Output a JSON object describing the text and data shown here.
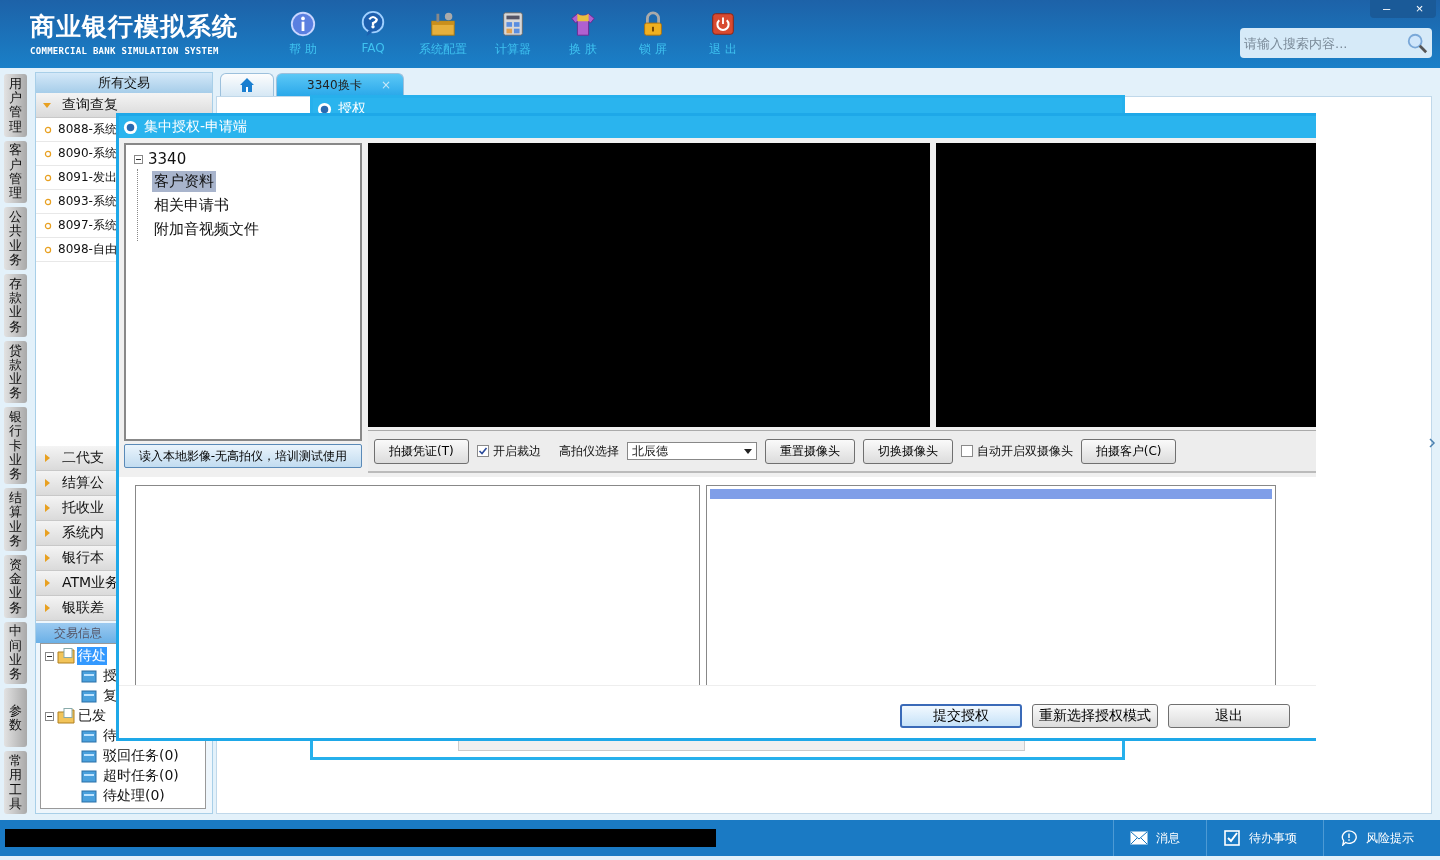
{
  "header": {
    "title": "商业银行模拟系统",
    "subtitle": "COMMERCIAL BANK SIMULATION SYSTEM",
    "tools": [
      {
        "kind": "info",
        "label": "帮 助"
      },
      {
        "kind": "faq",
        "label": "FAQ"
      },
      {
        "kind": "config",
        "label": "系统配置"
      },
      {
        "kind": "calculator",
        "label": "计算器"
      },
      {
        "kind": "skin",
        "label": "换 肤"
      },
      {
        "kind": "lock",
        "label": "锁 屏"
      },
      {
        "kind": "exit",
        "label": "退 出"
      }
    ],
    "window_controls": [
      "–",
      "×"
    ],
    "search": {
      "placeholder": "请输入搜索内容..."
    }
  },
  "side_tabs": [
    "用户管理",
    "客户管理",
    "公共业务",
    "存款业务",
    "贷款业务",
    "银行卡业务",
    "结算业务",
    "资金业务",
    "中间业务",
    "参数",
    "常用工具"
  ],
  "transactions": {
    "title": "所有交易",
    "groups": [
      {
        "label": "查询查复",
        "expanded": true,
        "items": [
          "8088-系统",
          "8090-系统",
          "8091-发出",
          "8093-系统",
          "8097-系统",
          "8098-自由"
        ]
      },
      {
        "label": "二代支",
        "expanded": false
      },
      {
        "label": "结算公",
        "expanded": false
      },
      {
        "label": "托收业",
        "expanded": false
      },
      {
        "label": "系统内",
        "expanded": false
      },
      {
        "label": "银行本",
        "expanded": false
      },
      {
        "label": "ATM业务",
        "expanded": false
      },
      {
        "label": "银联差",
        "expanded": false
      }
    ]
  },
  "info_panel": {
    "title": "交易信息",
    "tree": [
      {
        "label": "待处",
        "expanded": true,
        "selected": true,
        "children": [
          {
            "label": "授",
            "selected": false
          },
          {
            "label": "复",
            "selected": false
          }
        ]
      },
      {
        "label": "已发",
        "expanded": true,
        "selected": false,
        "children": [
          {
            "label": "待",
            "selected": false
          },
          {
            "label": "驳回任务(0)",
            "selected": false
          },
          {
            "label": "超时任务(0)",
            "selected": false
          },
          {
            "label": "待处理(0)",
            "selected": false
          }
        ]
      }
    ]
  },
  "tabs": [
    {
      "kind": "home",
      "selected": false
    },
    {
      "kind": "text",
      "label": "3340换卡",
      "close": "×",
      "selected": true
    }
  ],
  "back_dialog": {
    "title": "授权"
  },
  "dialog": {
    "title": "集中授权-申请端",
    "tree": {
      "label": "3340",
      "expanded": true,
      "children": [
        {
          "label": "客户资料",
          "selected": true
        },
        {
          "label": "相关申请书",
          "selected": false
        },
        {
          "label": "附加音视频文件",
          "selected": false
        }
      ]
    },
    "load_button": "读入本地影像-无高拍仪，培训测试使用",
    "toolbar": [
      {
        "kind": "button",
        "label": "拍摄凭证(T)"
      },
      {
        "kind": "checkbox",
        "label": "开启裁边",
        "checked": true
      },
      {
        "kind": "label",
        "label": "高拍仪选择"
      },
      {
        "kind": "select",
        "value": "北辰德"
      },
      {
        "kind": "button",
        "label": "重置摄像头"
      },
      {
        "kind": "button",
        "label": "切换摄像头"
      },
      {
        "kind": "checkbox",
        "label": "自动开启双摄像头",
        "checked": false
      },
      {
        "kind": "button",
        "label": "拍摄客户(C)"
      }
    ],
    "buttons": [
      {
        "label": "提交授权",
        "focused": true
      },
      {
        "label": "重新选择授权模式",
        "focused": false
      },
      {
        "label": "退出",
        "focused": false
      }
    ]
  },
  "status_bar": {
    "items": [
      {
        "kind": "message",
        "label": "消息"
      },
      {
        "kind": "todo",
        "label": "待办事项"
      },
      {
        "kind": "risk",
        "label": "风险提示"
      }
    ]
  }
}
